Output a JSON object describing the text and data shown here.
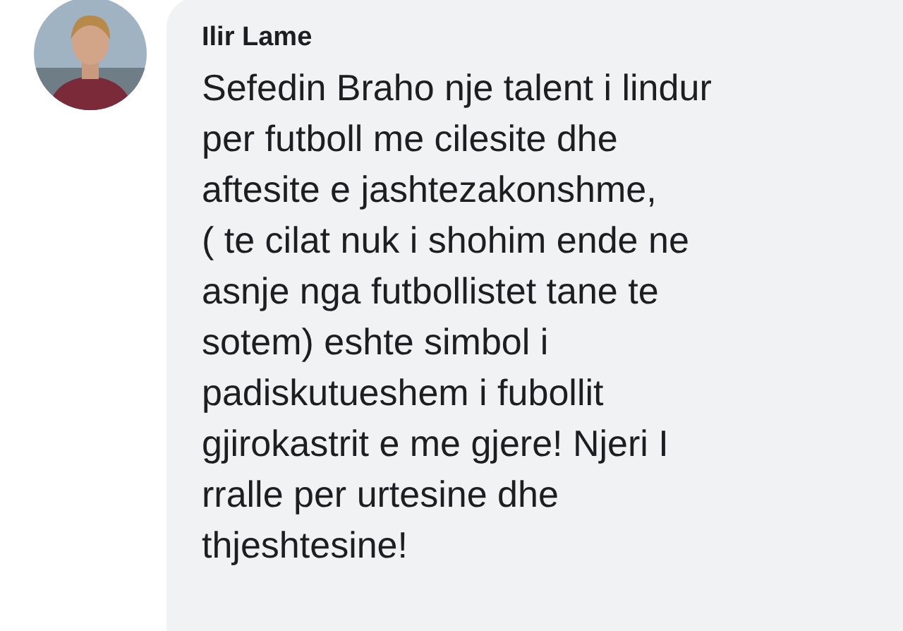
{
  "comment": {
    "author": "Ilir Lame",
    "text": "Sefedin Braho nje talent i lindur\nper futboll me cilesite dhe\naftesite e jashtezakonshme,\n( te cilat nuk i shohim ende ne\nasnje nga futbollistet tane te\nsotem) eshte simbol i\npadiskutueshem i fubollit\ngjirokastrit e me gjere! Njeri I\nrralle per urtesine dhe\nthjeshtesine!"
  }
}
